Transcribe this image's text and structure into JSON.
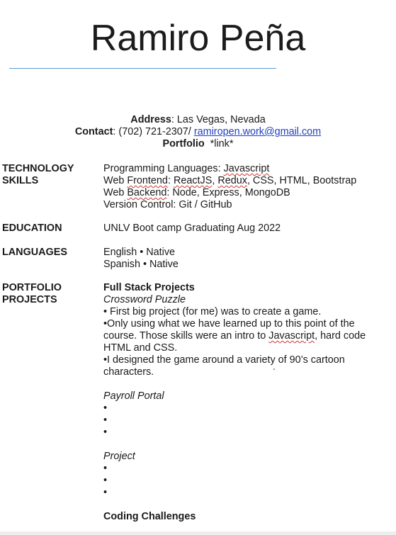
{
  "header": {
    "name": "Ramiro Peña"
  },
  "contact": {
    "address_label": "Address",
    "address_value": ": Las Vegas, Nevada",
    "contact_label": "Contact",
    "contact_value": ": (702) 721-2307/ ",
    "email": "ramiropen.work@gmail.com",
    "portfolio_label": "Portfolio",
    "portfolio_value": "  *link*"
  },
  "technology": {
    "label_line1": "TECHNOLOGY",
    "label_line2": "SKILLS",
    "programming_prefix": "Programming Languages: ",
    "programming_value": "Javascript",
    "web_frontend_prefix": "Web ",
    "web_frontend_word": "Frontend",
    "web_frontend_colon": ": ",
    "react": "ReactJS",
    "comma1": ", ",
    "redux": "Redux",
    "web_frontend_rest": ", CSS, HTML, Bootstrap",
    "web_backend_prefix": "Web ",
    "web_backend_word": "Backend",
    "web_backend_rest": ": Node, Express, MongoDB",
    "version_control": "Version Control: Git / GitHub"
  },
  "education": {
    "label": "EDUCATION",
    "value": "UNLV Boot camp Graduating Aug 2022"
  },
  "languages": {
    "label": "LANGUAGES",
    "items": [
      "English •  Native",
      "Spanish •  Native"
    ]
  },
  "portfolio_projects": {
    "label_line1": "PORTFOLIO",
    "label_line2": "PROJECTS",
    "heading": "Full Stack Projects",
    "project1_title": "Crossword Puzzle",
    "project1_bullet1": "• First big project (for me) was to create a game.",
    "project1_bullet2_part1": "•Only using  what we have learned up to this point of the course. Those skills were an intro to ",
    "project1_bullet2_js": "Javascript",
    "project1_bullet2_part2": ", hard code HTML and CSS.",
    "project1_bullet3": "•I designed the game around a variety of 90’s cartoon characters.",
    "project2_title": "Payroll Portal",
    "project2_bullets": [
      "•",
      "•",
      "•"
    ],
    "project3_title": "Project",
    "project3_bullets": [
      "•",
      "•",
      "•"
    ],
    "coding_heading": "Coding Challenges"
  }
}
